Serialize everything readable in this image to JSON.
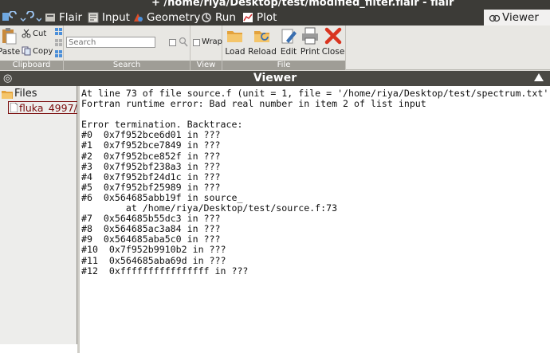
{
  "window": {
    "title": "+ /home/riya/Desktop/test/modified_filter.flair - flair"
  },
  "menu": {
    "tabs": [
      {
        "label": "Flair",
        "icon": "flair-icon"
      },
      {
        "label": "Input",
        "icon": "input-icon"
      },
      {
        "label": "Geometry",
        "icon": "geometry-icon"
      },
      {
        "label": "Run",
        "icon": "run-icon"
      },
      {
        "label": "Plot",
        "icon": "plot-icon"
      }
    ],
    "active_tab": "Viewer"
  },
  "ribbon": {
    "clipboard": {
      "label": "Clipboard",
      "paste": "Paste",
      "cut": "Cut",
      "copy": "Copy"
    },
    "search": {
      "label": "Search",
      "placeholder": "Search"
    },
    "view": {
      "label": "View",
      "wrap": "Wrap"
    },
    "file": {
      "label": "File",
      "load": "Load",
      "reload": "Reload",
      "edit": "Edit",
      "print": "Print",
      "close": "Close"
    }
  },
  "viewer": {
    "title": "Viewer",
    "tree": {
      "root": "Files",
      "file": "fluka_4997/"
    },
    "output": [
      "At line 73 of file source.f (unit = 1, file = '/home/riya/Desktop/test/spectrum.txt')",
      "Fortran runtime error: Bad real number in item 2 of list input",
      "",
      "Error termination. Backtrace:",
      "#0  0x7f952bce6d01 in ???",
      "#1  0x7f952bce7849 in ???",
      "#2  0x7f952bce852f in ???",
      "#3  0x7f952bf238a3 in ???",
      "#4  0x7f952bf24d1c in ???",
      "#5  0x7f952bf25989 in ???",
      "#6  0x564685abb19f in source_",
      "        at /home/riya/Desktop/test/source.f:73",
      "#7  0x564685b55dc3 in ???",
      "#8  0x564685ac3a84 in ???",
      "#9  0x564685aba5c0 in ???",
      "#10  0x7f952b9910b2 in ???",
      "#11  0x564685aba69d in ???",
      "#12  0xffffffffffffffff in ???"
    ]
  },
  "colors": {
    "titlebar": "#3c3b37",
    "group_label": "#9f9d96",
    "viewer_header": "#4a4944",
    "file_link": "#7a0c0c"
  }
}
